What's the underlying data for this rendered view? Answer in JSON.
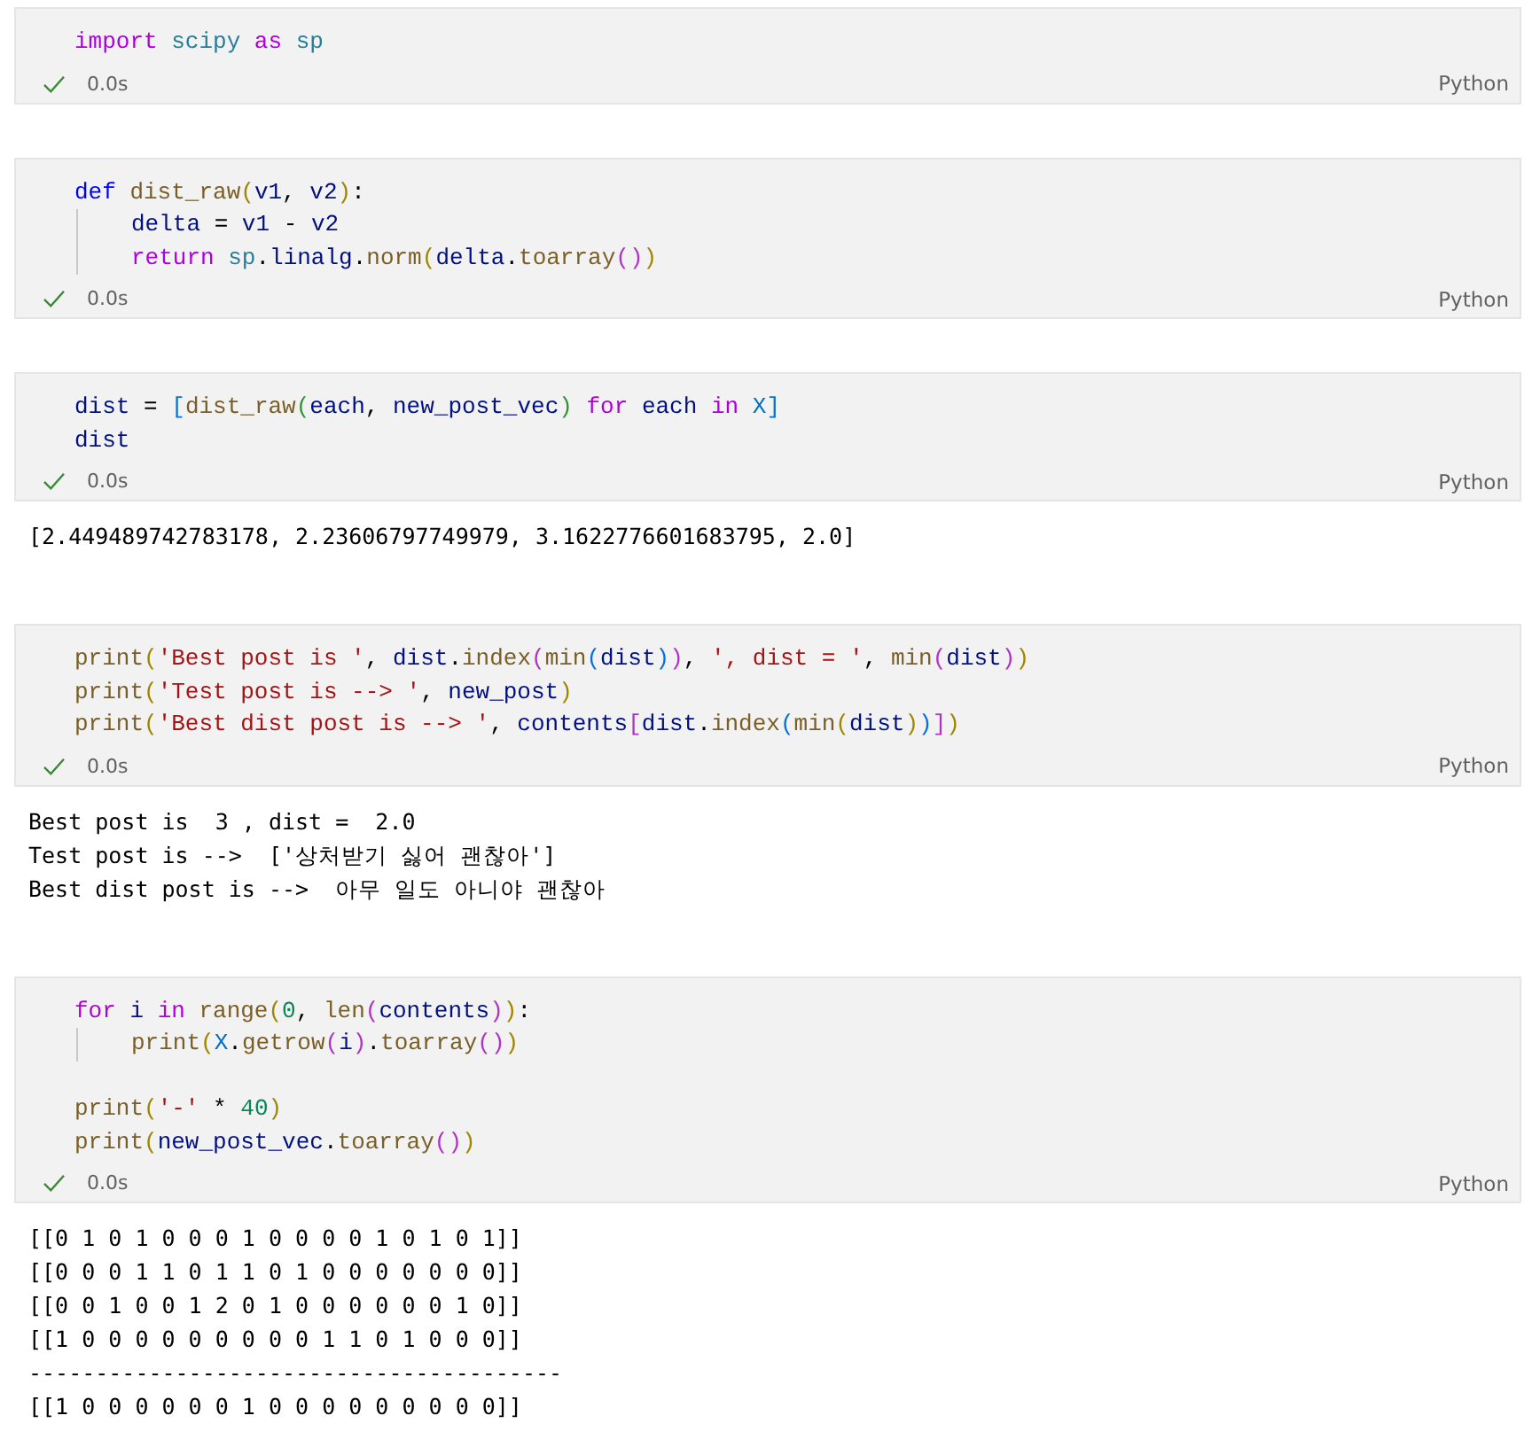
{
  "cells": [
    {
      "code": [
        {
          "kind": "code",
          "tokens": [
            {
              "kind": "kw",
              "t": "import"
            },
            {
              "kind": "mod",
              "t": " scipy"
            },
            {
              "kind": "kw",
              "t": " as"
            },
            {
              "kind": "mod",
              "t": " sp"
            }
          ]
        }
      ],
      "succeeded": true,
      "time": "0.0s",
      "language": "Python"
    },
    {
      "code": [
        {
          "kind": "code",
          "tokens": [
            {
              "kind": "def",
              "t": "def"
            },
            {
              "kind": "fn",
              "t": " dist_raw"
            },
            {
              "kind": "bg",
              "t": "("
            },
            {
              "kind": "var",
              "t": "v1"
            },
            {
              "kind": "op",
              "t": ", "
            },
            {
              "kind": "var",
              "t": "v2"
            },
            {
              "kind": "bg",
              "t": ")"
            },
            {
              "kind": "op",
              "t": ":"
            }
          ],
          "children": [
            {
              "kind": "code",
              "tokens": [
                {
                  "kind": "var",
                  "t": "delta"
                },
                {
                  "kind": "op",
                  "t": " = "
                },
                {
                  "kind": "var",
                  "t": "v1"
                },
                {
                  "kind": "op",
                  "t": " - "
                },
                {
                  "kind": "var",
                  "t": "v2"
                }
              ]
            },
            {
              "kind": "code",
              "tokens": [
                {
                  "kind": "kw",
                  "t": "return"
                },
                {
                  "kind": "mod",
                  "t": " sp"
                },
                {
                  "kind": "op",
                  "t": "."
                },
                {
                  "kind": "var",
                  "t": "linalg"
                },
                {
                  "kind": "op",
                  "t": "."
                },
                {
                  "kind": "fn",
                  "t": "norm"
                },
                {
                  "kind": "bg",
                  "t": "("
                },
                {
                  "kind": "var",
                  "t": "delta"
                },
                {
                  "kind": "op",
                  "t": "."
                },
                {
                  "kind": "fn",
                  "t": "toarray"
                },
                {
                  "kind": "bp",
                  "t": "("
                },
                {
                  "kind": "bp",
                  "t": ")"
                },
                {
                  "kind": "bg",
                  "t": ")"
                }
              ]
            }
          ]
        }
      ],
      "succeeded": true,
      "time": "0.0s",
      "language": "Python"
    },
    {
      "code": [
        {
          "kind": "code",
          "tokens": [
            {
              "kind": "var",
              "t": "dist"
            },
            {
              "kind": "op",
              "t": " = "
            },
            {
              "kind": "bb",
              "t": "["
            },
            {
              "kind": "fn",
              "t": "dist_raw"
            },
            {
              "kind": "bt",
              "t": "("
            },
            {
              "kind": "var",
              "t": "each"
            },
            {
              "kind": "op",
              "t": ", "
            },
            {
              "kind": "var",
              "t": "new_post_vec"
            },
            {
              "kind": "bt",
              "t": ")"
            },
            {
              "kind": "kw",
              "t": " for"
            },
            {
              "kind": "var",
              "t": " each"
            },
            {
              "kind": "kw",
              "t": " in"
            },
            {
              "kind": "const",
              "t": " X"
            },
            {
              "kind": "bb",
              "t": "]"
            }
          ]
        },
        {
          "kind": "code",
          "tokens": [
            {
              "kind": "var",
              "t": "dist"
            }
          ]
        }
      ],
      "succeeded": true,
      "time": "0.0s",
      "language": "Python",
      "output": [
        "[2.449489742783178, 2.23606797749979, 3.1622776601683795, 2.0]"
      ]
    },
    {
      "code": [
        {
          "kind": "code",
          "tokens": [
            {
              "kind": "fn",
              "t": "print"
            },
            {
              "kind": "bg",
              "t": "("
            },
            {
              "kind": "str",
              "t": "'Best post is '"
            },
            {
              "kind": "op",
              "t": ", "
            },
            {
              "kind": "var",
              "t": "dist"
            },
            {
              "kind": "op",
              "t": "."
            },
            {
              "kind": "fn",
              "t": "index"
            },
            {
              "kind": "bp",
              "t": "("
            },
            {
              "kind": "fn",
              "t": "min"
            },
            {
              "kind": "bb",
              "t": "("
            },
            {
              "kind": "var",
              "t": "dist"
            },
            {
              "kind": "bb",
              "t": ")"
            },
            {
              "kind": "bp",
              "t": ")"
            },
            {
              "kind": "op",
              "t": ", "
            },
            {
              "kind": "str",
              "t": "', dist = '"
            },
            {
              "kind": "op",
              "t": ", "
            },
            {
              "kind": "fn",
              "t": "min"
            },
            {
              "kind": "bp",
              "t": "("
            },
            {
              "kind": "var",
              "t": "dist"
            },
            {
              "kind": "bp",
              "t": ")"
            },
            {
              "kind": "bg",
              "t": ")"
            }
          ]
        },
        {
          "kind": "code",
          "tokens": [
            {
              "kind": "fn",
              "t": "print"
            },
            {
              "kind": "bg",
              "t": "("
            },
            {
              "kind": "str",
              "t": "'Test post is --> '"
            },
            {
              "kind": "op",
              "t": ", "
            },
            {
              "kind": "var",
              "t": "new_post"
            },
            {
              "kind": "bg",
              "t": ")"
            }
          ]
        },
        {
          "kind": "code",
          "tokens": [
            {
              "kind": "fn",
              "t": "print"
            },
            {
              "kind": "bg",
              "t": "("
            },
            {
              "kind": "str",
              "t": "'Best dist post is --> '"
            },
            {
              "kind": "op",
              "t": ", "
            },
            {
              "kind": "var",
              "t": "contents"
            },
            {
              "kind": "bp",
              "t": "["
            },
            {
              "kind": "var",
              "t": "dist"
            },
            {
              "kind": "op",
              "t": "."
            },
            {
              "kind": "fn",
              "t": "index"
            },
            {
              "kind": "bb",
              "t": "("
            },
            {
              "kind": "fn",
              "t": "min"
            },
            {
              "kind": "bg",
              "t": "("
            },
            {
              "kind": "var",
              "t": "dist"
            },
            {
              "kind": "bg",
              "t": ")"
            },
            {
              "kind": "bb",
              "t": ")"
            },
            {
              "kind": "bp",
              "t": "]"
            },
            {
              "kind": "bg",
              "t": ")"
            }
          ]
        }
      ],
      "succeeded": true,
      "time": "0.0s",
      "language": "Python",
      "output": [
        "Best post is  3 , dist =  2.0",
        "Test post is -->  ['상처받기 싫어 괜찮아']",
        "Best dist post is -->  아무 일도 아니야 괜찮아"
      ]
    },
    {
      "code": [
        {
          "kind": "code",
          "tokens": [
            {
              "kind": "kw",
              "t": "for"
            },
            {
              "kind": "var",
              "t": " i"
            },
            {
              "kind": "kw",
              "t": " in"
            },
            {
              "kind": "fn",
              "t": " range"
            },
            {
              "kind": "bg",
              "t": "("
            },
            {
              "kind": "num",
              "t": "0"
            },
            {
              "kind": "op",
              "t": ", "
            },
            {
              "kind": "fn",
              "t": "len"
            },
            {
              "kind": "bp",
              "t": "("
            },
            {
              "kind": "var",
              "t": "contents"
            },
            {
              "kind": "bp",
              "t": ")"
            },
            {
              "kind": "bg",
              "t": ")"
            },
            {
              "kind": "op",
              "t": ":"
            }
          ],
          "children": [
            {
              "kind": "code",
              "tokens": [
                {
                  "kind": "fn",
                  "t": "print"
                },
                {
                  "kind": "bg",
                  "t": "("
                },
                {
                  "kind": "const",
                  "t": "X"
                },
                {
                  "kind": "op",
                  "t": "."
                },
                {
                  "kind": "fn",
                  "t": "getrow"
                },
                {
                  "kind": "bp",
                  "t": "("
                },
                {
                  "kind": "var",
                  "t": "i"
                },
                {
                  "kind": "bp",
                  "t": ")"
                },
                {
                  "kind": "op",
                  "t": "."
                },
                {
                  "kind": "fn",
                  "t": "toarray"
                },
                {
                  "kind": "bp",
                  "t": "("
                },
                {
                  "kind": "bp",
                  "t": ")"
                },
                {
                  "kind": "bg",
                  "t": ")"
                }
              ]
            }
          ]
        },
        {
          "kind": "blank"
        },
        {
          "kind": "code",
          "tokens": [
            {
              "kind": "fn",
              "t": "print"
            },
            {
              "kind": "bg",
              "t": "("
            },
            {
              "kind": "str",
              "t": "'-'"
            },
            {
              "kind": "op",
              "t": " * "
            },
            {
              "kind": "num",
              "t": "40"
            },
            {
              "kind": "bg",
              "t": ")"
            }
          ]
        },
        {
          "kind": "code",
          "tokens": [
            {
              "kind": "fn",
              "t": "print"
            },
            {
              "kind": "bg",
              "t": "("
            },
            {
              "kind": "var",
              "t": "new_post_vec"
            },
            {
              "kind": "op",
              "t": "."
            },
            {
              "kind": "fn",
              "t": "toarray"
            },
            {
              "kind": "bp",
              "t": "("
            },
            {
              "kind": "bp",
              "t": ")"
            },
            {
              "kind": "bg",
              "t": ")"
            }
          ]
        }
      ],
      "succeeded": true,
      "time": "0.0s",
      "language": "Python",
      "output": [
        "[[0 1 0 1 0 0 0 1 0 0 0 0 1 0 1 0 1]]",
        "[[0 0 0 1 1 0 1 1 0 1 0 0 0 0 0 0 0]]",
        "[[0 0 1 0 0 1 2 0 1 0 0 0 0 0 0 1 0]]",
        "[[1 0 0 0 0 0 0 0 0 0 1 1 0 1 0 0 0]]",
        "----------------------------------------",
        "[[1 0 0 0 0 0 0 1 0 0 0 0 0 0 0 0 0]]"
      ]
    }
  ]
}
